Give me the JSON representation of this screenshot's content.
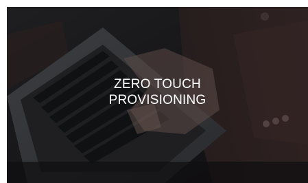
{
  "card": {
    "title_line1": "ZERO TOUCH",
    "title_line2": "PROVISIONING",
    "image_subject": "person-typing-on-laptop",
    "overlay_color": "#0a0a0c"
  }
}
